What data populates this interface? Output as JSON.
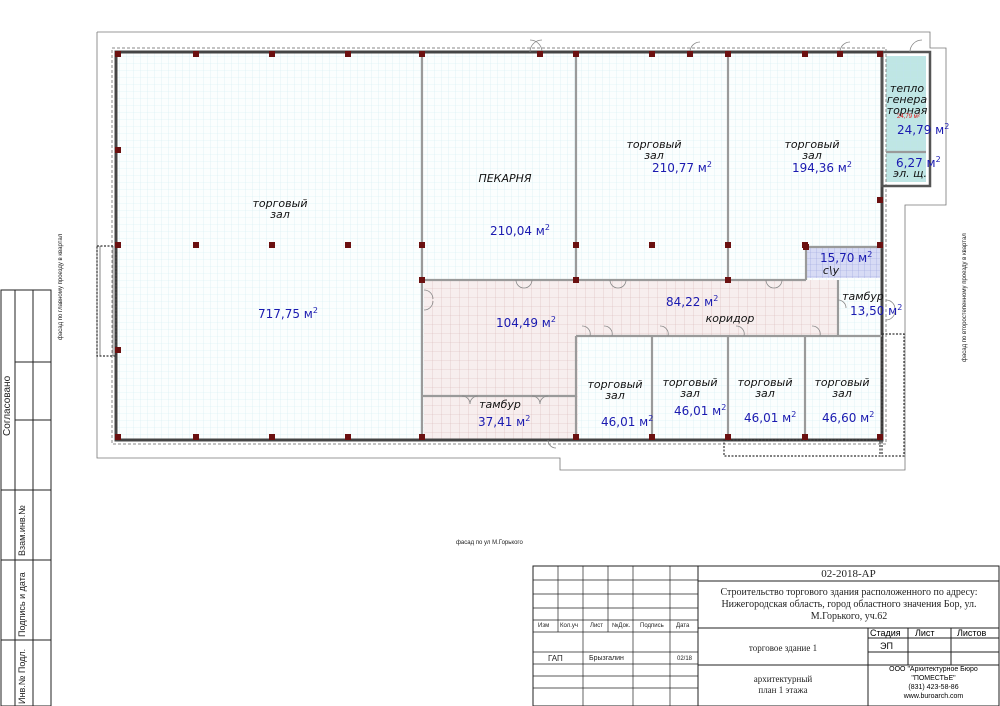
{
  "plan": {
    "rooms": [
      {
        "id": "big-hall",
        "name": "торговый\nзал",
        "area": "717,75 м"
      },
      {
        "id": "bakery",
        "name": "ПЕКАРНЯ",
        "area": "210,04 м"
      },
      {
        "id": "hall-2",
        "name": "торговый\nзал",
        "area": "210,77 м"
      },
      {
        "id": "hall-3",
        "name": "торговый\nзал",
        "area": "194,36 м"
      },
      {
        "id": "heat",
        "name": "тепло\nгенера\nторная",
        "area": "24,79 м",
        "area_small": "24,79 м²"
      },
      {
        "id": "el",
        "name": "эл. щ.",
        "area": "6,27 м"
      },
      {
        "id": "wc",
        "name": "с\\у",
        "area": "15,70 м"
      },
      {
        "id": "corridor-left",
        "name": "",
        "area": "104,49 м"
      },
      {
        "id": "corridor",
        "name": "коридор",
        "area": "84,22 м"
      },
      {
        "id": "vestibule-right",
        "name": "тамбур",
        "area": "13,50 м"
      },
      {
        "id": "vestibule-bottom",
        "name": "тамбур",
        "area": "37,41 м"
      },
      {
        "id": "shop-1",
        "name": "торговый\nзал",
        "area": "46,01 м"
      },
      {
        "id": "shop-2",
        "name": "торговый\nзал",
        "area": "46,01 м"
      },
      {
        "id": "shop-3",
        "name": "торговый\nзал",
        "area": "46,01 м"
      },
      {
        "id": "shop-4",
        "name": "торговый\nзал",
        "area": "46,60 м"
      }
    ],
    "area_sup": "2",
    "facade_left": "фасад по главному проезду в квартал",
    "facade_right": "фасад по второстепенному проезду в квартал",
    "facade_bottom": "фасад по ул М.Горького"
  },
  "left_strip": {
    "agreed": "Согласовано",
    "inv_no": "Взам.инв.№",
    "sign_date": "Подпись и дата",
    "inv_orig": "Инв.№ Подл."
  },
  "title_block": {
    "code": "02-2018-АР",
    "project": "Строительство торгового здания расположенного по адресу: Нижегородская область, город областного значения Бор, ул. М.Горького, уч.62",
    "headers": [
      "Изм",
      "Кол.уч",
      "Лист",
      "№Док.",
      "Подпись",
      "Дата"
    ],
    "gap_label": "ГАП",
    "gap_name": "Брызгалин",
    "gap_date": "02/18",
    "building": "торговое здание 1",
    "stage_h": "Стадия",
    "sheet_h": "Лист",
    "sheets_h": "Листов",
    "stage_val": "ЭП",
    "drawing": "архитектурный\nплан 1 этажа",
    "org_line1": "ООО \"Архитектурное Бюро",
    "org_line2": "\"ПОМЕСТЬЕ\"",
    "org_phone": "(831) 423-58-86",
    "org_site": "www.buroarch.com"
  }
}
